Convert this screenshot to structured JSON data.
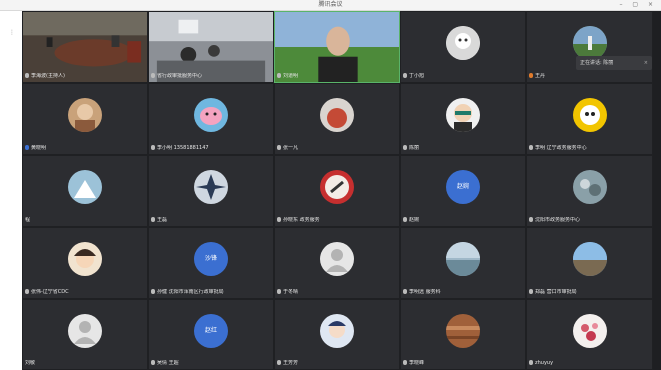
{
  "window": {
    "title": "腾讯会议"
  },
  "toast": {
    "text": "正在讲话: 陈丽",
    "close": "×"
  },
  "tiles": [
    {
      "name": "李海波(主持人)",
      "kind": "video-room"
    },
    {
      "name": "省行政审批服务中心",
      "kind": "video-office"
    },
    {
      "name": "刘道明",
      "kind": "video-person"
    },
    {
      "name": "丁小旭",
      "kind": "avatar"
    },
    {
      "name": "王丹",
      "kind": "avatar"
    },
    {
      "name": "黄晓明",
      "kind": "avatar"
    },
    {
      "name": "李小明 13581881147",
      "kind": "avatar"
    },
    {
      "name": "张一凡",
      "kind": "avatar"
    },
    {
      "name": "陈丽",
      "kind": "avatar"
    },
    {
      "name": "李明 辽宁政务服务中心",
      "kind": "avatar"
    },
    {
      "name": "程",
      "kind": "avatar"
    },
    {
      "name": "王磊",
      "kind": "avatar"
    },
    {
      "name": "孙晓东 政务服务",
      "kind": "avatar"
    },
    {
      "name": "赵婉",
      "kind": "avatar",
      "text": "赵婉"
    },
    {
      "name": "沈阳市政务服务中心",
      "kind": "avatar"
    },
    {
      "name": "张伟-辽宁省CDC",
      "kind": "avatar"
    },
    {
      "name": "孙健 沈阳市浑南区行政审批局",
      "kind": "avatar",
      "text": "沙锋"
    },
    {
      "name": "于冬晴",
      "kind": "avatar"
    },
    {
      "name": "李明远 服务科",
      "kind": "avatar"
    },
    {
      "name": "郑磊 营口市审批局",
      "kind": "avatar"
    },
    {
      "name": "刘敏",
      "kind": "avatar"
    },
    {
      "name": "吴倩 王超",
      "kind": "avatar",
      "text": "赵红"
    },
    {
      "name": "王芳芳",
      "kind": "avatar"
    },
    {
      "name": "李晓峰",
      "kind": "avatar"
    },
    {
      "name": "zhuyuy",
      "kind": "avatar"
    }
  ]
}
